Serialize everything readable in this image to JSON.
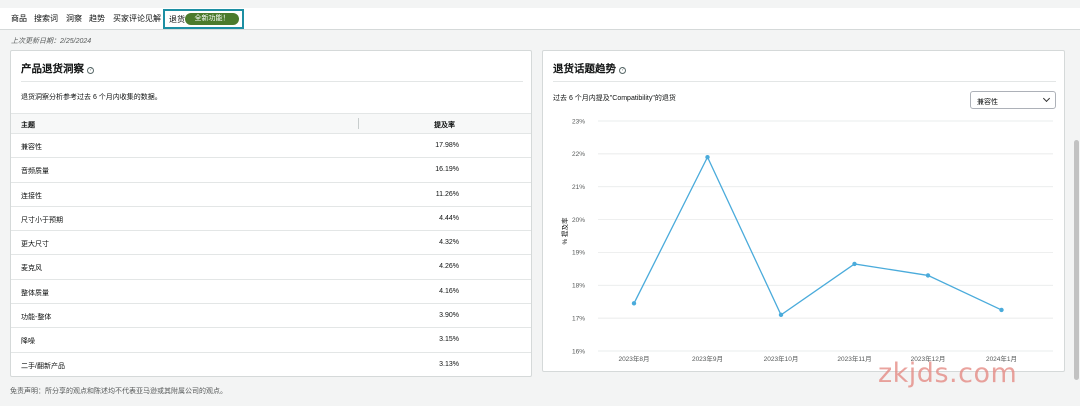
{
  "tabs": [
    {
      "label": "商品"
    },
    {
      "label": "搜索词"
    },
    {
      "label": "洞察"
    },
    {
      "label": "趋势"
    },
    {
      "label": "买家评论见解"
    }
  ],
  "active_tab": {
    "label": "退货",
    "badge": "全新功能！"
  },
  "last_updated": "上次更新日期：2/25/2024",
  "left_card": {
    "title": "产品退货洞察",
    "description": "退货洞察分析参考过去 6 个月内收集的数据。",
    "columns": {
      "topic": "主题",
      "rate": "提及率"
    },
    "rows": [
      {
        "topic": "兼容性",
        "rate": "17.98%"
      },
      {
        "topic": "音频质量",
        "rate": "16.19%"
      },
      {
        "topic": "连接性",
        "rate": "11.26%"
      },
      {
        "topic": "尺寸小于预期",
        "rate": "4.44%"
      },
      {
        "topic": "更大尺寸",
        "rate": "4.32%"
      },
      {
        "topic": "麦克风",
        "rate": "4.26%"
      },
      {
        "topic": "整体质量",
        "rate": "4.16%"
      },
      {
        "topic": "功能-整体",
        "rate": "3.90%"
      },
      {
        "topic": "降噪",
        "rate": "3.15%"
      },
      {
        "topic": "二手/翻新产品",
        "rate": "3.13%"
      }
    ]
  },
  "disclaimer": "免责声明：所分享的观点和陈述均不代表亚马逊或其附属公司的观点。",
  "right_card": {
    "title": "退货话题趋势",
    "description": "过去 6 个月内提及\"Compatibility\"的退货",
    "select_value": "兼容性"
  },
  "chart_data": {
    "type": "line",
    "x": [
      "2023年8月",
      "2023年9月",
      "2023年10月",
      "2023年11月",
      "2023年12月",
      "2024年1月"
    ],
    "series": [
      {
        "values": [
          17.45,
          21.9,
          17.1,
          18.65,
          18.3,
          17.25
        ]
      }
    ],
    "ylabel": "% 提及率",
    "yticks": [
      "16%",
      "17%",
      "18%",
      "19%",
      "20%",
      "21%",
      "22%",
      "23%"
    ],
    "ylim": [
      16,
      23
    ],
    "grid": true,
    "line_color": "#4aabdb"
  },
  "watermark": "zkjds.com"
}
